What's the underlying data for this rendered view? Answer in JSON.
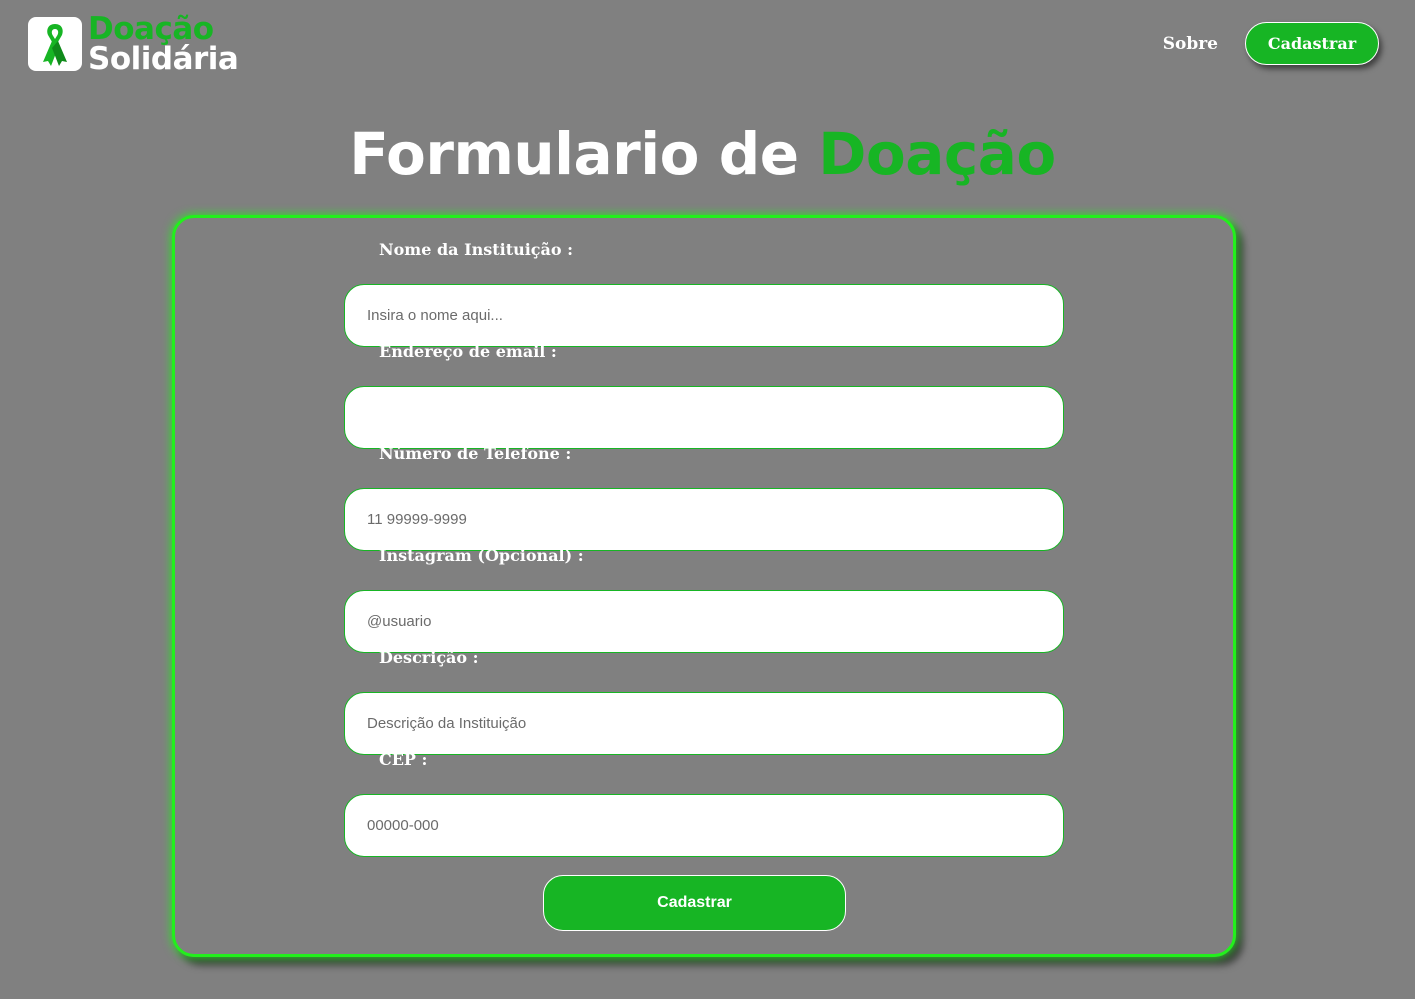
{
  "brand": {
    "line1": "Doação",
    "line2": "Solidária",
    "icon": "ribbon-icon",
    "color": "#17b524"
  },
  "nav": {
    "about_label": "Sobre",
    "register_label": "Cadastrar"
  },
  "title": {
    "part1": "Formulario de",
    "part2": "Doação"
  },
  "form": {
    "fields": [
      {
        "label": "Nome da Instituição :",
        "placeholder": "Insira o nome aqui..."
      },
      {
        "label": "Endereço de email :",
        "placeholder": ""
      },
      {
        "label": "Número de Telefone :",
        "placeholder": "11 99999-9999"
      },
      {
        "label": "Instagram (Opcional) :",
        "placeholder": "@usuario"
      },
      {
        "label": "Descrição :",
        "placeholder": "Descrição da Instituição"
      },
      {
        "label": "CEP :",
        "placeholder": "00000-000"
      }
    ],
    "submit_label": "Cadastrar"
  },
  "colors": {
    "background": "#808080",
    "accent": "#17b524",
    "card_border": "#22f01c"
  }
}
